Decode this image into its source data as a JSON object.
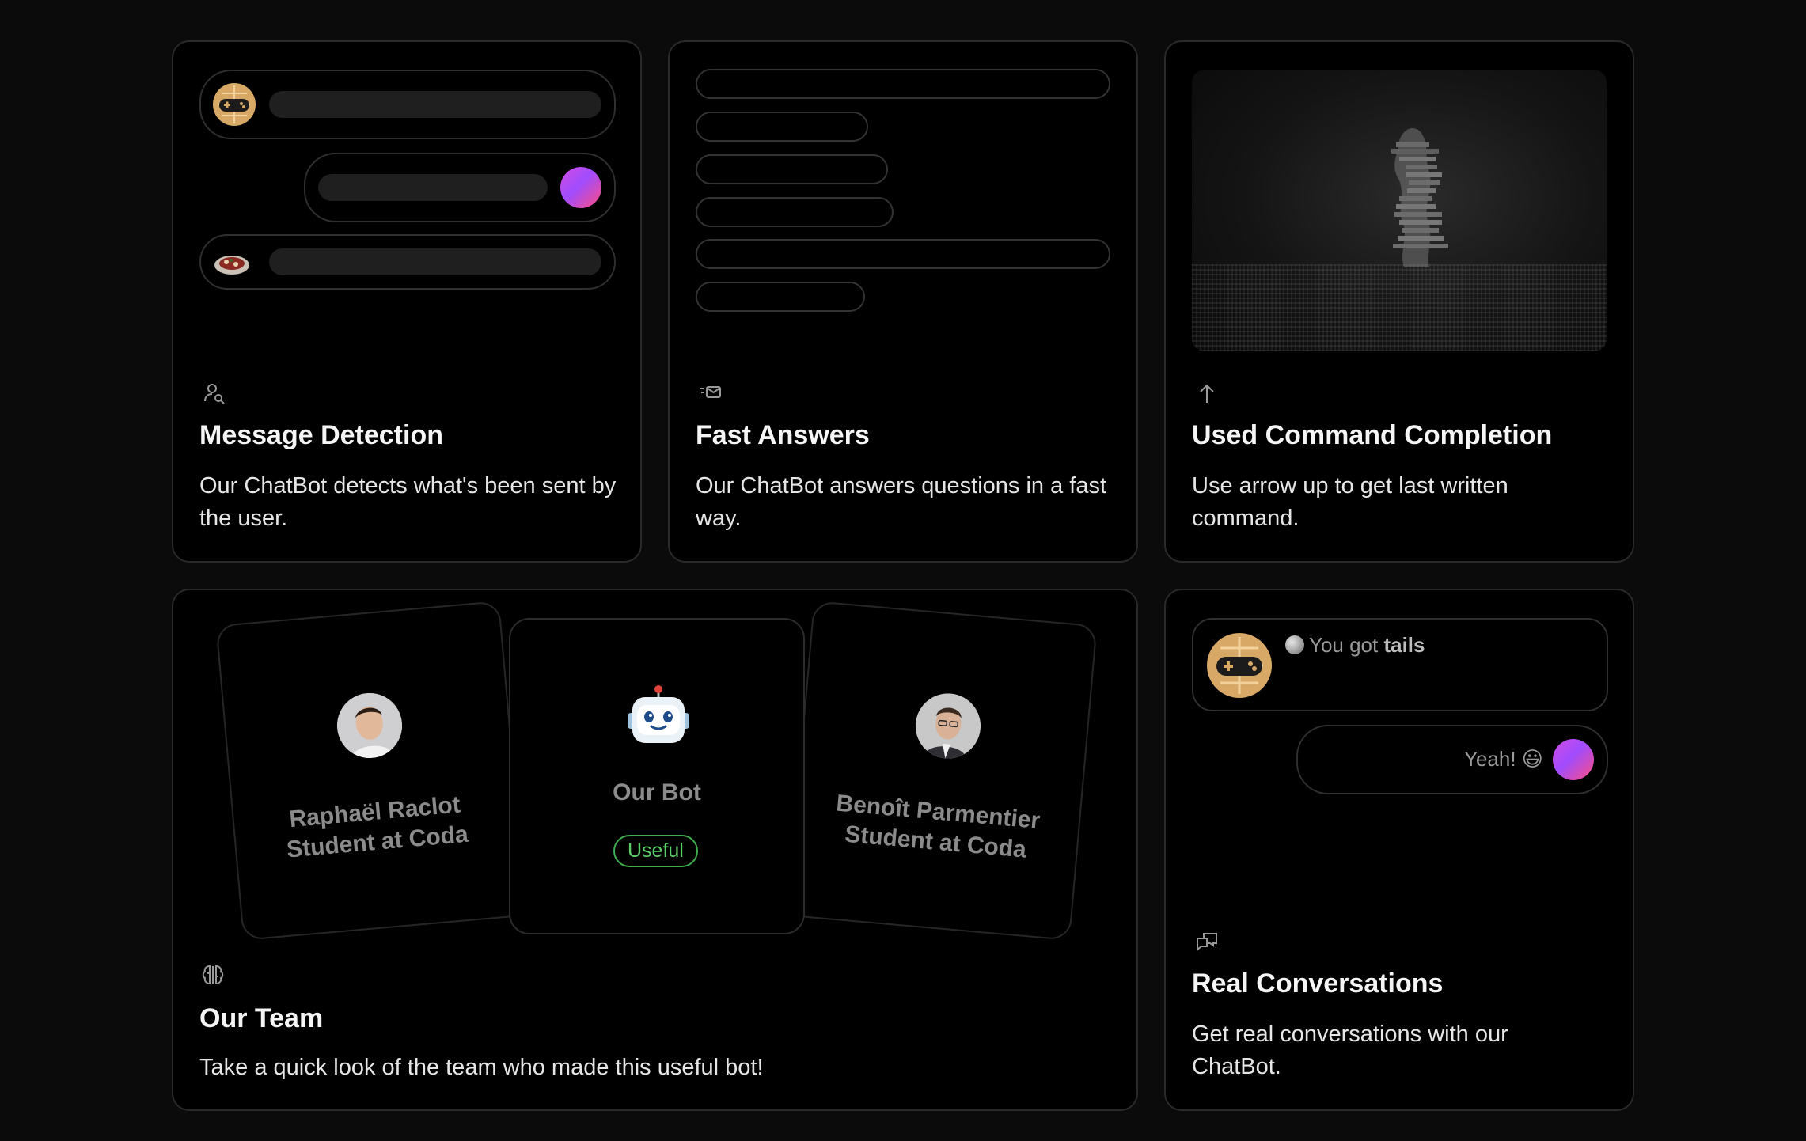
{
  "features": {
    "message_detection": {
      "title": "Message Detection",
      "description": "Our ChatBot detects what's been sent by the user.",
      "icon": "user-search-icon"
    },
    "fast_answers": {
      "title": "Fast Answers",
      "description": "Our ChatBot answers questions in a fast way.",
      "icon": "mail-send-icon"
    },
    "command_completion": {
      "title": "Used Command Completion",
      "description": "Use arrow up to get last written command.",
      "icon": "arrow-up-icon"
    },
    "team": {
      "title": "Our Team",
      "description": "Take a quick look of the team who made this useful bot!",
      "icon": "brain-icon",
      "members": [
        {
          "name": "Raphaël Raclot",
          "role": "Student at Coda"
        },
        {
          "name": "Our Bot",
          "badge": "Useful"
        },
        {
          "name": "Benoît Parmentier",
          "role": "Student at Coda"
        }
      ]
    },
    "conversations": {
      "title": "Real Conversations",
      "description": "Get real conversations with our ChatBot.",
      "icon": "chat-bubbles-icon",
      "bot_message_prefix": "You got ",
      "bot_message_bold": "tails",
      "user_message": "Yeah! 😃"
    }
  },
  "colors": {
    "background": "#0b0b0b",
    "card_border": "#2a2a2a",
    "badge_green": "#5bcf6a",
    "avatar_gradient": [
      "#d24ce0",
      "#a14cff",
      "#ff4d7d"
    ]
  }
}
